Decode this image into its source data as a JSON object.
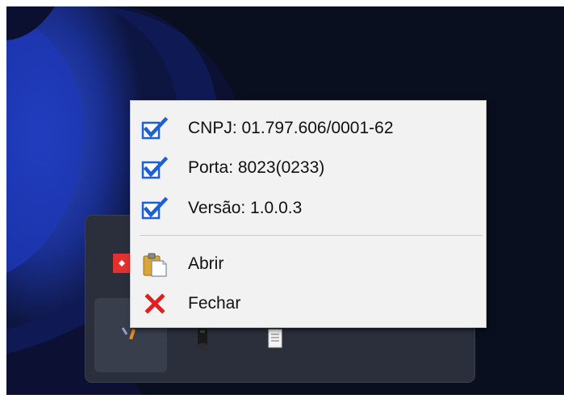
{
  "context_menu": {
    "items": [
      {
        "label": "CNPJ: 01.797.606/0001-62",
        "icon": "checkbox-checked-icon",
        "checked": true
      },
      {
        "label": "Porta: 8023(0233)",
        "icon": "checkbox-checked-icon",
        "checked": true
      },
      {
        "label": "Versão: 1.0.0.3",
        "icon": "checkbox-checked-icon",
        "checked": true
      },
      {
        "label": "Abrir",
        "icon": "clipboard-icon"
      },
      {
        "label": "Fechar",
        "icon": "close-x-icon"
      }
    ]
  },
  "tray": {
    "icons": [
      "red-app-icon",
      "pen-app-icon",
      "usb-drive-icon",
      "document-icon"
    ]
  },
  "colors": {
    "checkbox_blue": "#1c5fd6",
    "close_red": "#e02020",
    "menu_bg": "#f2f2f2",
    "tray_bg": "#2a2f3b"
  }
}
